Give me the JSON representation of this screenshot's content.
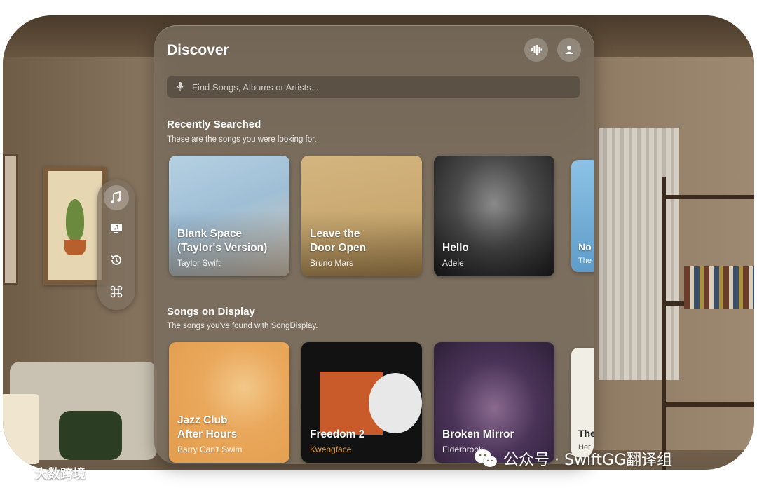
{
  "window": {
    "title": "Discover"
  },
  "header": {
    "buttons": [
      {
        "icon": "waveform-icon"
      },
      {
        "icon": "person-icon"
      }
    ]
  },
  "search": {
    "placeholder": "Find Songs, Albums or Artists...",
    "value": "",
    "icon": "mic-icon"
  },
  "recently_searched": {
    "title": "Recently Searched",
    "subtitle": "These are the songs you were looking for.",
    "cards": [
      {
        "title": "Blank Space\n(Taylor's Version)",
        "artist": "Taylor Swift",
        "color": "#9fbfd6"
      },
      {
        "title": "Leave the\nDoor Open",
        "artist": "Bruno Mars",
        "color": "#c9a86f"
      },
      {
        "title": "Hello",
        "artist": "Adele",
        "color": "#3a3a3a"
      },
      {
        "title": "No",
        "artist": "The",
        "color": "#7fb3d8"
      }
    ]
  },
  "songs_on_display": {
    "title": "Songs on Display",
    "subtitle": "The songs you've found with SongDisplay.",
    "cards": [
      {
        "title": "Jazz Club\nAfter Hours",
        "artist": "Barry Can't Swim",
        "color": "#e8a557"
      },
      {
        "title": "Freedom 2",
        "artist": "Kwengface",
        "color": "#121212",
        "artist_color": "#f0a23a"
      },
      {
        "title": "Broken Mirror",
        "artist": "Elderbrook",
        "color": "#3b2a4a"
      },
      {
        "title": "The Tab",
        "artist": "Her",
        "color": "#f1eee6"
      }
    ]
  },
  "ornament": {
    "items": [
      {
        "icon": "music-notes-icon",
        "active": true
      },
      {
        "icon": "music-display-icon",
        "active": false
      },
      {
        "icon": "history-icon",
        "active": false
      },
      {
        "icon": "command-icon",
        "active": false
      }
    ]
  },
  "watermarks": {
    "right": "公众号 · SwiftGG翻译组",
    "left": "大数跨境"
  }
}
